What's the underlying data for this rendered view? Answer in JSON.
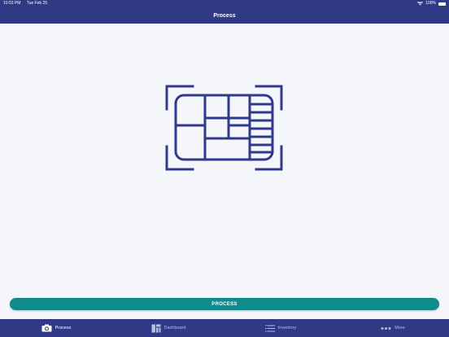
{
  "status_bar": {
    "time": "10:53 PM",
    "date": "Tue Feb 25",
    "battery": "100%"
  },
  "nav": {
    "title": "Process"
  },
  "main": {
    "icon": "floor-plan-scan-icon",
    "icon_color": "#2f3a8f",
    "button_label": "PROCESS",
    "button_color": "#0f8b8d"
  },
  "tabs": [
    {
      "label": "Process",
      "icon": "camera-icon",
      "active": true
    },
    {
      "label": "Dashboard",
      "icon": "dashboard-icon",
      "active": false
    },
    {
      "label": "Inventory",
      "icon": "list-icon",
      "active": false
    },
    {
      "label": "More",
      "icon": "more-dots-icon",
      "active": false
    }
  ],
  "colors": {
    "bar": "#303986",
    "background": "#f5f6fa",
    "tab_inactive": "#b9bde0",
    "tab_active": "#ffffff"
  }
}
